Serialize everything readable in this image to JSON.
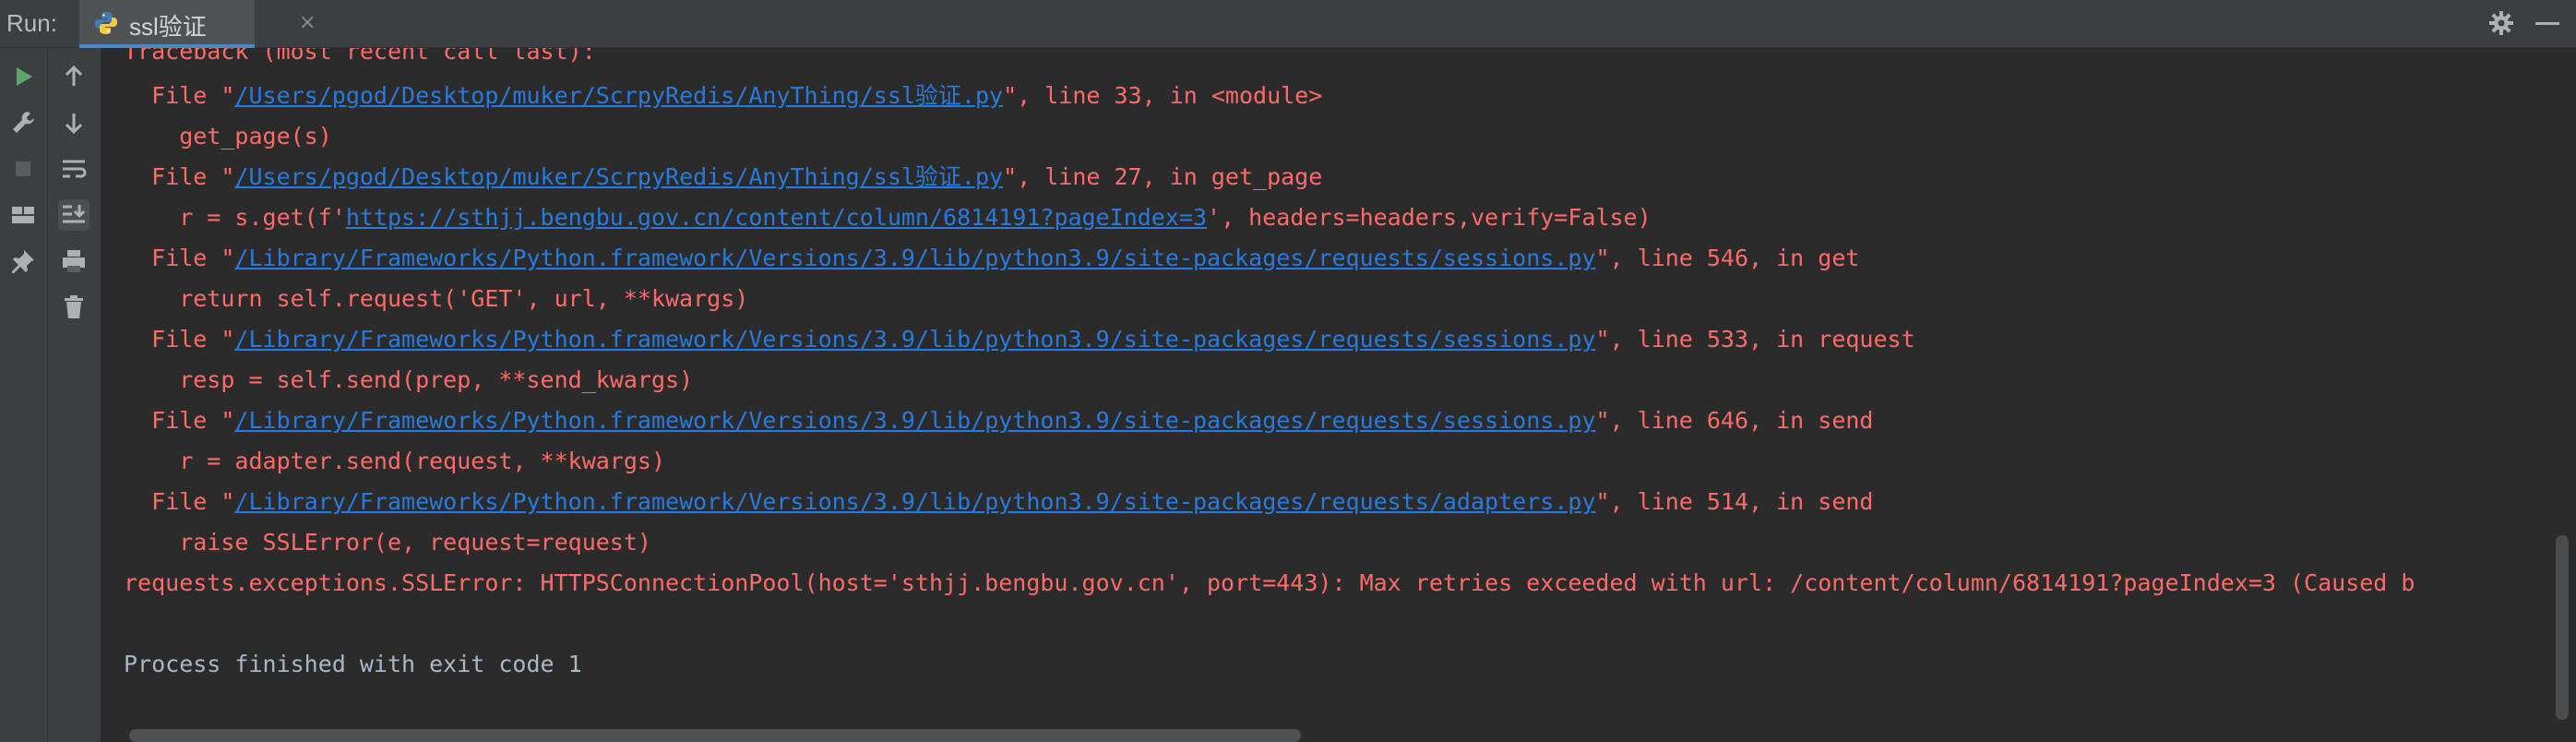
{
  "header": {
    "run_label": "Run:",
    "tab_label": "ssl验证",
    "tab_close": "×"
  },
  "icons": {
    "python": "python-file-icon",
    "settings": "gear-icon",
    "minimize": "minimize-icon",
    "run": "run-play-icon",
    "wrench": "wrench-icon",
    "stop": "stop-icon",
    "layout": "layout-icon",
    "pin": "pin-icon",
    "up": "arrow-up-icon",
    "down": "arrow-down-icon",
    "wrap": "soft-wrap-icon",
    "scroll_end": "scroll-to-end-icon",
    "print": "print-icon",
    "trash": "trash-icon"
  },
  "colors": {
    "error": "#ff6b68",
    "link": "#287bde",
    "normal": "#a9b7c6",
    "play": "#59a869"
  },
  "console": {
    "l0": {
      "text": "Traceback (most recent call last):"
    },
    "l1": {
      "a": "  File \"",
      "link": "/Users/pgod/Desktop/muker/ScrpyRedis/AnyThing/ssl验证.py",
      "b": "\", line 33, in <module>"
    },
    "l2": {
      "text": "    get_page(s)"
    },
    "l3": {
      "a": "  File \"",
      "link": "/Users/pgod/Desktop/muker/ScrpyRedis/AnyThing/ssl验证.py",
      "b": "\", line 27, in get_page"
    },
    "l4": {
      "a": "    r = s.get(f'",
      "link": "https://sthjj.bengbu.gov.cn/content/column/6814191?pageIndex=3",
      "b": "', headers=headers,verify=False)"
    },
    "l5": {
      "a": "  File \"",
      "link": "/Library/Frameworks/Python.framework/Versions/3.9/lib/python3.9/site-packages/requests/sessions.py",
      "b": "\", line 546, in get"
    },
    "l6": {
      "text": "    return self.request('GET', url, **kwargs)"
    },
    "l7": {
      "a": "  File \"",
      "link": "/Library/Frameworks/Python.framework/Versions/3.9/lib/python3.9/site-packages/requests/sessions.py",
      "b": "\", line 533, in request"
    },
    "l8": {
      "text": "    resp = self.send(prep, **send_kwargs)"
    },
    "l9": {
      "a": "  File \"",
      "link": "/Library/Frameworks/Python.framework/Versions/3.9/lib/python3.9/site-packages/requests/sessions.py",
      "b": "\", line 646, in send"
    },
    "l10": {
      "text": "    r = adapter.send(request, **kwargs)"
    },
    "l11": {
      "a": "  File \"",
      "link": "/Library/Frameworks/Python.framework/Versions/3.9/lib/python3.9/site-packages/requests/adapters.py",
      "b": "\", line 514, in send"
    },
    "l12": {
      "text": "    raise SSLError(e, request=request)"
    },
    "l13": {
      "text": "requests.exceptions.SSLError: HTTPSConnectionPool(host='sthjj.bengbu.gov.cn', port=443): Max retries exceeded with url: /content/column/6814191?pageIndex=3 (Caused b"
    },
    "l14": {
      "text": "Process finished with exit code 1"
    }
  }
}
